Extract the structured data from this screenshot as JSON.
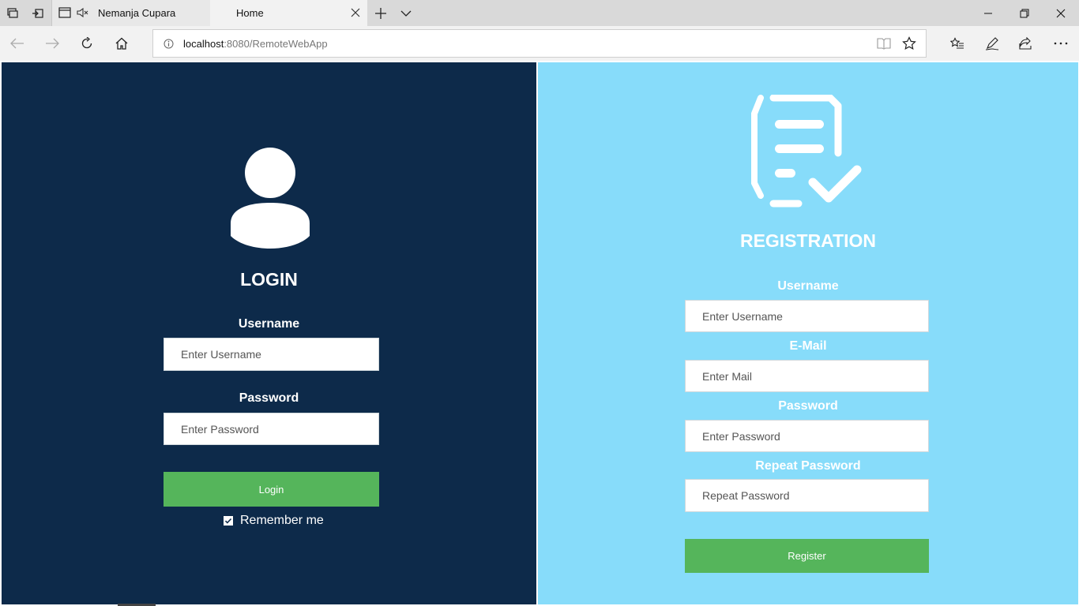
{
  "browser": {
    "tabs": [
      {
        "title": "Nemanja Cupara",
        "muted": true
      },
      {
        "title": "Home",
        "active": true
      }
    ],
    "address": {
      "host": "localhost",
      "path": ":8080/RemoteWebApp"
    }
  },
  "login": {
    "title": "LOGIN",
    "username_label": "Username",
    "username_placeholder": "Enter Username",
    "password_label": "Password",
    "password_placeholder": "Enter Password",
    "button": "Login",
    "remember": "Remember me",
    "remember_checked": true
  },
  "registration": {
    "title": "REGISTRATION",
    "username_label": "Username",
    "username_placeholder": "Enter Username",
    "email_label": "E-Mail",
    "email_placeholder": "Enter Mail",
    "password_label": "Password",
    "password_placeholder": "Enter Password",
    "repeat_label": "Repeat Password",
    "repeat_placeholder": "Repeat Password",
    "button": "Register"
  },
  "colors": {
    "login_bg": "#0d2a4a",
    "registration_bg": "#87dcfa",
    "button_green": "#55b55b"
  },
  "icons": [
    "tab-actions-icon",
    "set-aside-tabs-icon",
    "tab-page-icon",
    "muted-speaker-icon",
    "close-icon",
    "new-tab-icon",
    "tab-list-chevron-icon",
    "minimize-icon",
    "restore-icon",
    "window-close-icon",
    "back-icon",
    "forward-icon",
    "refresh-icon",
    "home-icon",
    "site-info-icon",
    "reading-view-icon",
    "favorite-star-icon",
    "favorites-hub-icon",
    "pen-icon",
    "share-icon",
    "more-icon",
    "user-icon",
    "registration-form-icon"
  ]
}
